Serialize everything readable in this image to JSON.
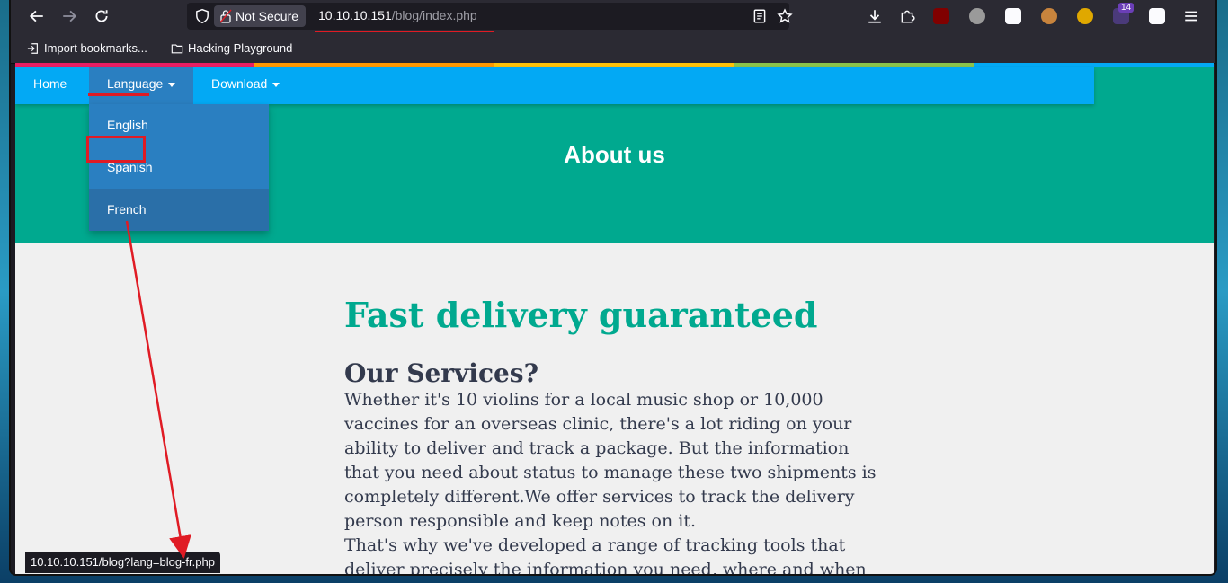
{
  "browser": {
    "security_label": "Not Secure",
    "url_host": "10.10.10.151",
    "url_path": "/blog/index.php",
    "bookmarks": [
      "Import bookmarks...",
      "Hacking Playground"
    ],
    "extension_badge": "14",
    "status_url": "10.10.10.151/blog?lang=blog-fr.php"
  },
  "nav": {
    "home": "Home",
    "language": "Language",
    "download": "Download"
  },
  "dropdown": {
    "items": [
      "English",
      "Spanish",
      "French"
    ]
  },
  "hero": {
    "title": "About us"
  },
  "content": {
    "heading": "Fast delivery guaranteed",
    "subheading": "Our Services?",
    "paragraph1": "Whether it's 10 violins for a local music shop or 10,000 vaccines for an overseas clinic, there's a lot riding on your ability to deliver and track a package. But the information that you need about status to manage these two shipments is completely different.We offer services to track the delivery person responsible and keep notes on it.",
    "paragraph2": "That's why we've developed a range of tracking tools that deliver precisely the information you need, where and when"
  },
  "colors": {
    "hero": "#00a98f",
    "navbar": "#03a9f4",
    "dropdown": "#2a7fc1",
    "annotation": "#e01b24",
    "heading": "#00a98f",
    "text": "#333a4d"
  }
}
